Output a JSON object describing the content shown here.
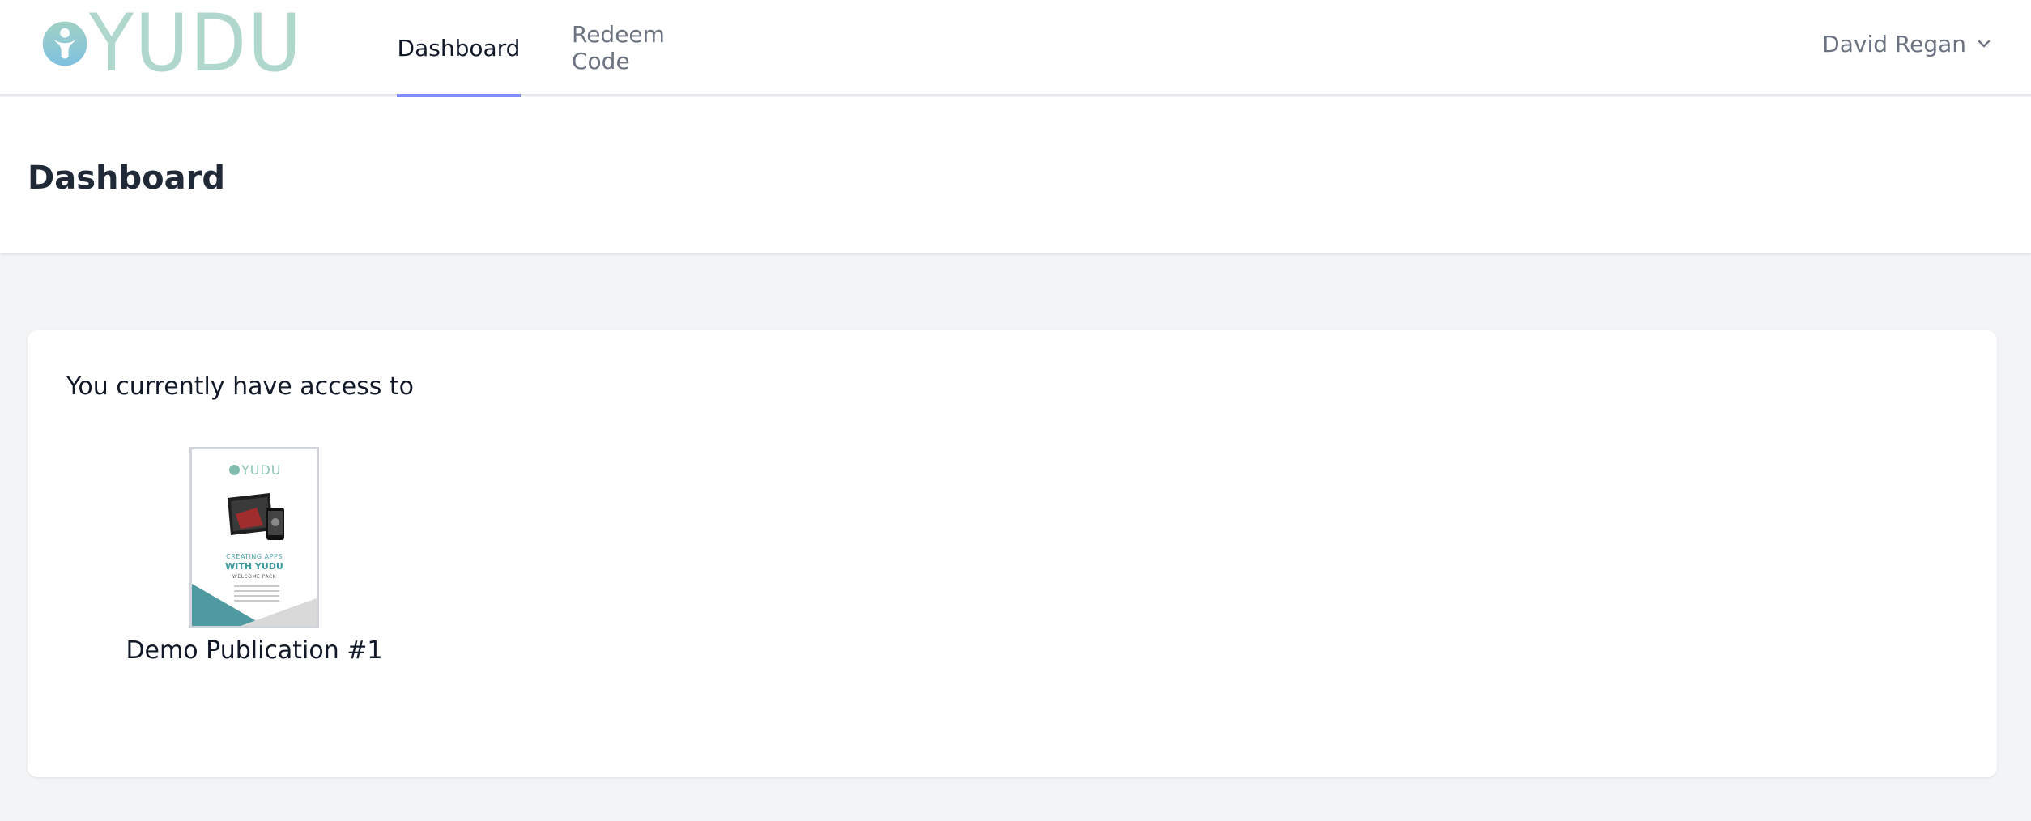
{
  "brand": {
    "name": "YUDU",
    "logo_color": "#a8d3c7"
  },
  "nav": {
    "tabs": [
      {
        "label": "Dashboard",
        "active": true
      },
      {
        "label": "Redeem Code",
        "active": false
      }
    ],
    "active_indicator_color": "#818cf8"
  },
  "user": {
    "name": "David Regan",
    "menu_icon": "chevron-down-icon"
  },
  "page": {
    "title": "Dashboard"
  },
  "access": {
    "heading": "You currently have access to",
    "publications": [
      {
        "title": "Demo Publication #1",
        "cover": {
          "brand": "YUDU",
          "line1": "CREATING APPS",
          "line2": "WITH YUDU",
          "line3": "WELCOME PACK"
        }
      }
    ]
  }
}
